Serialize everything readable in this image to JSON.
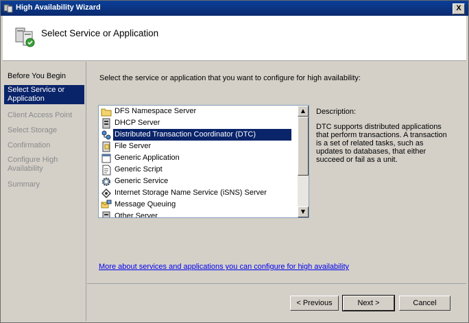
{
  "window": {
    "title": "High Availability Wizard",
    "close_glyph": "X"
  },
  "header": {
    "heading": "Select Service or Application"
  },
  "steps": [
    {
      "label": "Before You Begin",
      "state": "done"
    },
    {
      "label": "Select Service or Application",
      "state": "active"
    },
    {
      "label": "Client Access Point",
      "state": "pending"
    },
    {
      "label": "Select Storage",
      "state": "pending"
    },
    {
      "label": "Confirmation",
      "state": "pending"
    },
    {
      "label": "Configure High Availability",
      "state": "pending"
    },
    {
      "label": "Summary",
      "state": "pending"
    }
  ],
  "main": {
    "instruction": "Select the service or application that you want to configure for high availability:",
    "services": [
      {
        "label": "DFS Namespace Server",
        "icon": "folder-icon"
      },
      {
        "label": "DHCP Server",
        "icon": "server-icon"
      },
      {
        "label": "Distributed Transaction Coordinator (DTC)",
        "icon": "dtc-icon",
        "selected": true
      },
      {
        "label": "File Server",
        "icon": "file-server-icon"
      },
      {
        "label": "Generic Application",
        "icon": "application-icon"
      },
      {
        "label": "Generic Script",
        "icon": "script-icon"
      },
      {
        "label": "Generic Service",
        "icon": "gear-icon"
      },
      {
        "label": "Internet Storage Name Service (iSNS) Server",
        "icon": "isns-icon"
      },
      {
        "label": "Message Queuing",
        "icon": "message-queue-icon"
      },
      {
        "label": "Other Server",
        "icon": "server-icon"
      }
    ],
    "description_label": "Description:",
    "description_text": "DTC supports distributed applications that perform transactions. A transaction is a set of related tasks, such as updates to databases, that either succeed or fail as a unit.",
    "more_link": "More about services and applications you can configure for high availability"
  },
  "buttons": {
    "previous": "< Previous",
    "next": "Next >",
    "cancel": "Cancel"
  },
  "colors": {
    "title_bar": "#0a246a",
    "selection": "#0a246a",
    "link": "#0000ee"
  }
}
